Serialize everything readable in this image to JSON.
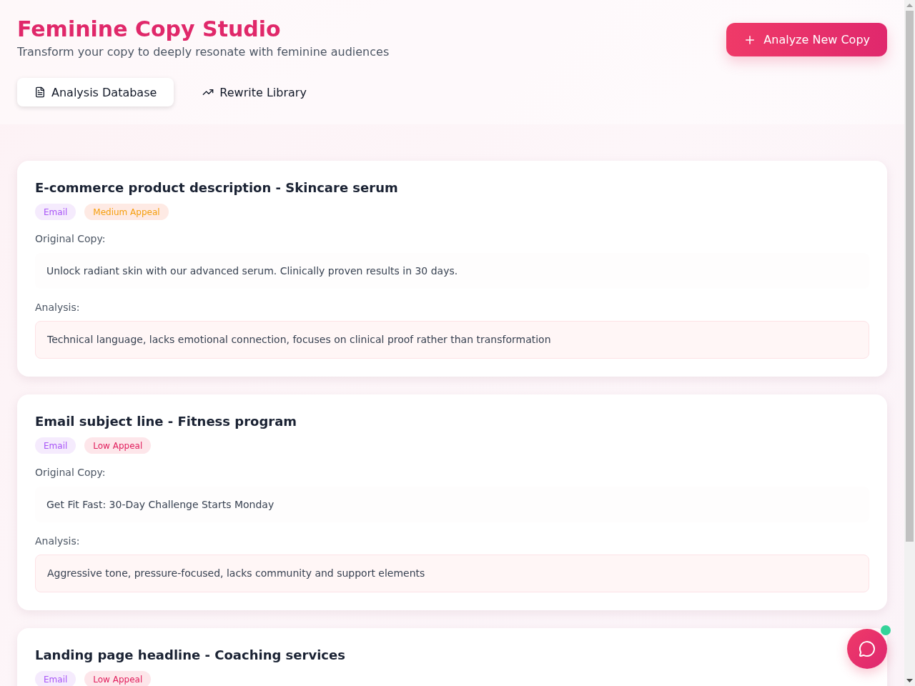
{
  "header": {
    "title": "Feminine Copy Studio",
    "subtitle": "Transform your copy to deeply resonate with feminine audiences",
    "action": "Analyze New Copy"
  },
  "tabs": [
    {
      "label": "Analysis Database",
      "selected": true
    },
    {
      "label": "Rewrite Library",
      "selected": false
    }
  ],
  "cards": [
    {
      "title": "E-commerce product description - Skincare serum",
      "tags": [
        {
          "label": "Email",
          "kind": "channel"
        },
        {
          "label": "Medium Appeal",
          "kind": "medium"
        }
      ],
      "original_label": "Original Copy:",
      "original": "Unlock radiant skin with our advanced serum. Clinically proven results in 30 days.",
      "analysis_label": "Analysis:",
      "analysis": "Technical language, lacks emotional connection, focuses on clinical proof rather than transformation"
    },
    {
      "title": "Email subject line - Fitness program",
      "tags": [
        {
          "label": "Email",
          "kind": "channel"
        },
        {
          "label": "Low Appeal",
          "kind": "low"
        }
      ],
      "original_label": "Original Copy:",
      "original": "Get Fit Fast: 30-Day Challenge Starts Monday",
      "analysis_label": "Analysis:",
      "analysis": "Aggressive tone, pressure-focused, lacks community and support elements"
    },
    {
      "title": "Landing page headline - Coaching services",
      "tags": [
        {
          "label": "Email",
          "kind": "channel"
        },
        {
          "label": "Low Appeal",
          "kind": "low"
        }
      ]
    }
  ],
  "chat": {
    "online": true
  }
}
